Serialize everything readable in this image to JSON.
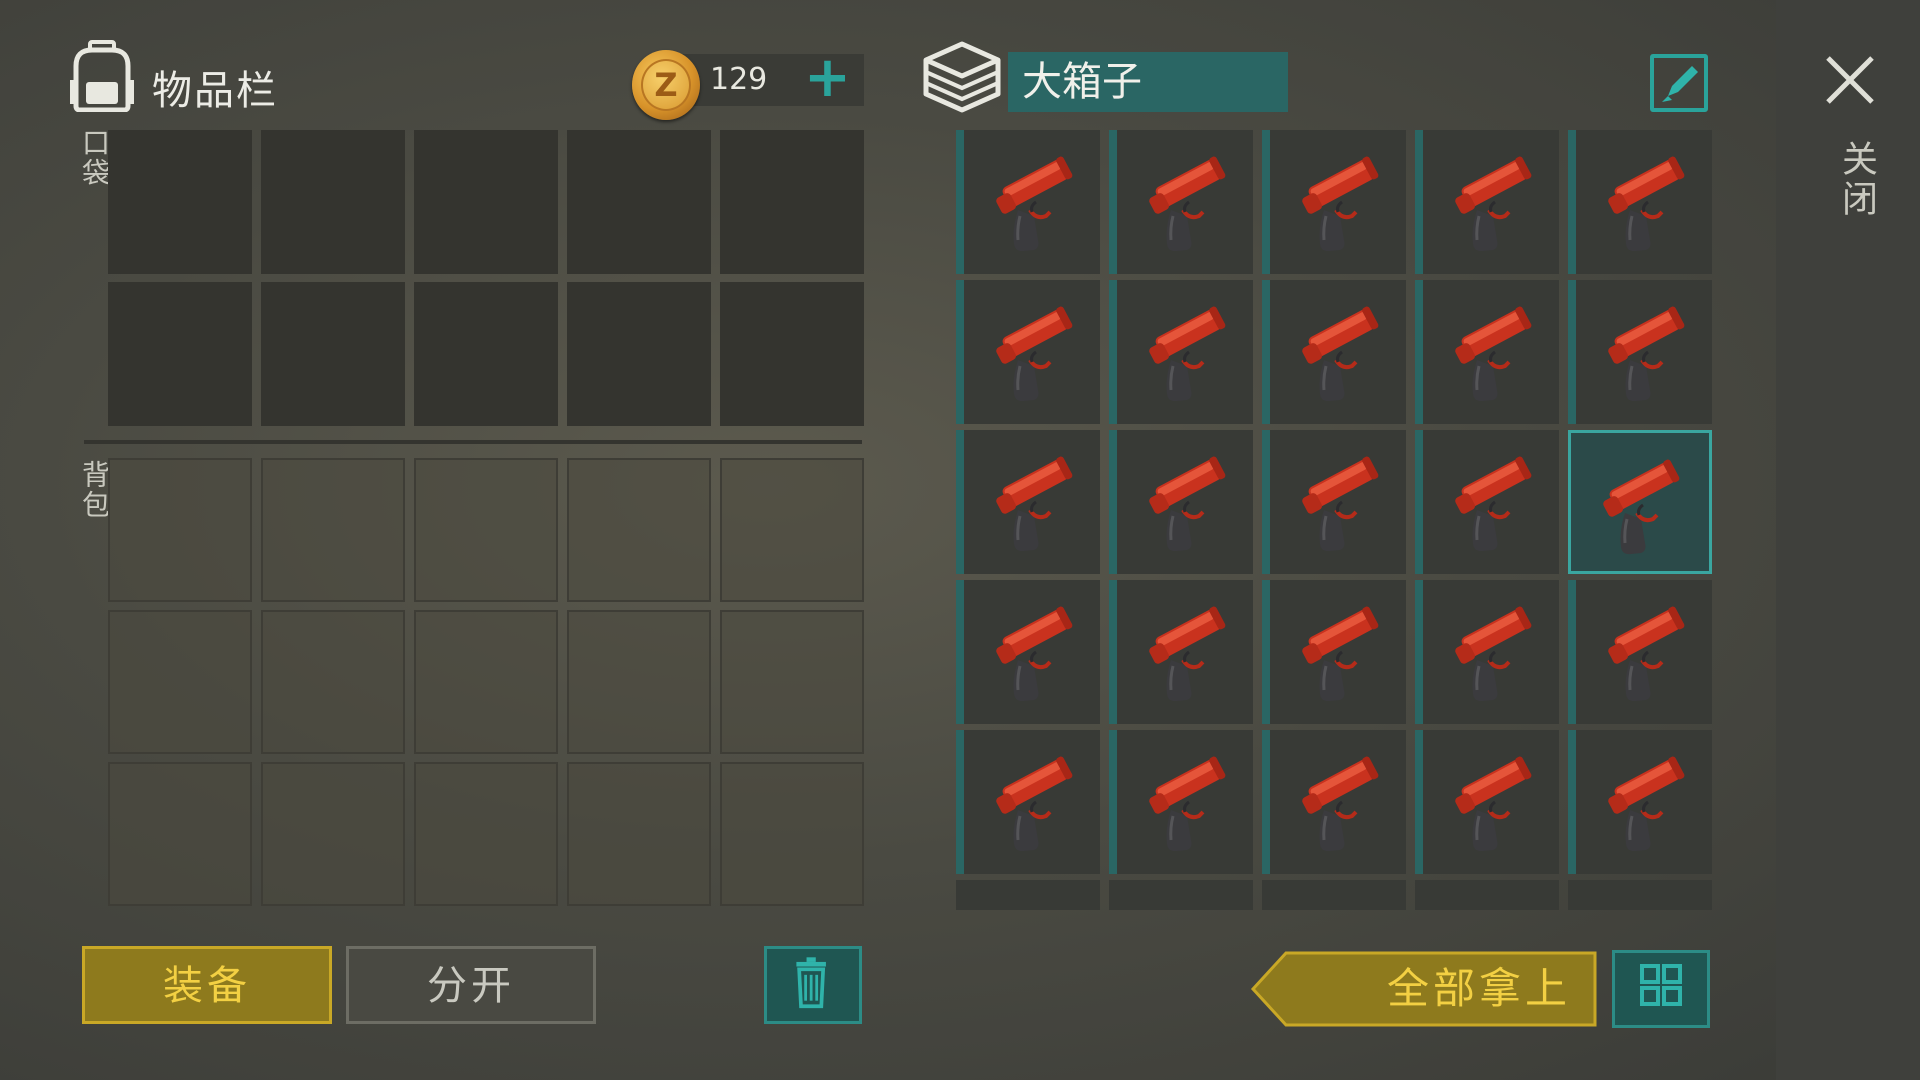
{
  "inventory": {
    "title": "物品栏",
    "pocket_label": "口袋",
    "backpack_label": "背包",
    "coins": "129",
    "coin_symbol": "Z",
    "add_symbol": "+"
  },
  "chest": {
    "name": "大箱子",
    "item_icon": "flare-gun-icon",
    "filled_slots": 25,
    "selected_slot": {
      "row": 2,
      "col": 4
    }
  },
  "buttons": {
    "equip": "装备",
    "split": "分开",
    "take_all": "全部拿上"
  },
  "side": {
    "close_label": "关闭"
  },
  "colors": {
    "accent_teal": "#2aa39b",
    "gold": "#f3d043",
    "flare_gun_red": "#d23a22"
  }
}
